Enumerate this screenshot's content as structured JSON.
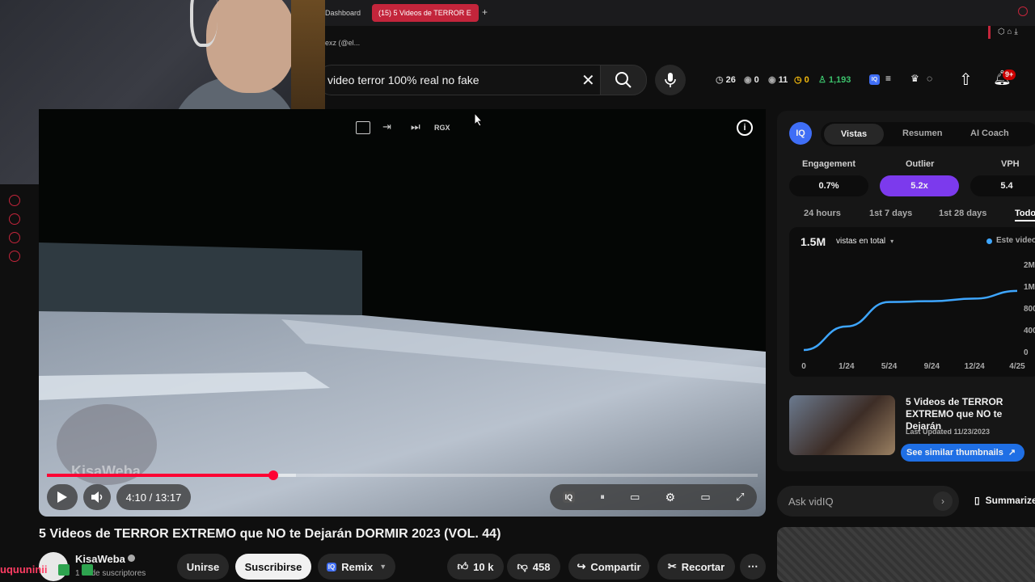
{
  "browser": {
    "tabs": [
      {
        "label": "Dashboard"
      },
      {
        "label": "(15) 5 Videos de TERROR E"
      }
    ],
    "bookmark": "exz (@el..."
  },
  "search": {
    "query": "video terror 100% real no fake"
  },
  "header_stats": {
    "s1": "26",
    "s2": "0",
    "s3": "11",
    "s4": "0",
    "s5": "1,193",
    "notif_badge": "9+"
  },
  "player": {
    "overlay_label": "RGX",
    "time": "4:10 / 13:17",
    "progress_fraction": 0.318,
    "buffer_fraction": 0.35,
    "watermark": "KisaWeba"
  },
  "video": {
    "title": "5 Videos de TERROR EXTREMO que NO te Dejarán DORMIR 2023 (VOL. 44)",
    "channel": "KisaWeba",
    "subscribers": "1 M de suscriptores",
    "join_label": "Unirse",
    "subscribe_label": "Suscribirse",
    "remix_label": "Remix",
    "likes": "10 k",
    "dislikes": "458",
    "share_label": "Compartir",
    "clip_label": "Recortar"
  },
  "chat_user": "uquuninii",
  "vidiq": {
    "logo": "IQ",
    "tabs": [
      "Vistas",
      "Resumen",
      "AI Coach"
    ],
    "metrics": [
      {
        "label": "Engagement",
        "value": "0.7%"
      },
      {
        "label": "Outlier",
        "value": "5.2x"
      },
      {
        "label": "VPH",
        "value": "5.4"
      }
    ],
    "ranges": [
      "24 hours",
      "1st 7 days",
      "1st 28 days",
      "Todo"
    ],
    "total_views": "1.5M",
    "views_selector": "vistas en total",
    "legend": "Este video",
    "thumb": {
      "title": "5 Videos de TERROR EXTREMO que NO te Dejarán",
      "updated": "Last Updated 11/23/2023",
      "similar_label": "See similar thumbnails"
    },
    "ask_placeholder": "Ask vidIQ",
    "summarize_label": "Summarize"
  },
  "chart_data": {
    "type": "line",
    "x": [
      "0",
      "1/24",
      "5/24",
      "9/24",
      "12/24",
      "4/25"
    ],
    "y_ticks": [
      "2M",
      "1M",
      "800",
      "400",
      "0"
    ],
    "series": [
      {
        "name": "Este video",
        "values": [
          0.0,
          0.55,
          1.12,
          1.14,
          1.2,
          1.38
        ]
      }
    ],
    "ylim": [
      0,
      2.0
    ],
    "color": "#3ea6ff"
  }
}
